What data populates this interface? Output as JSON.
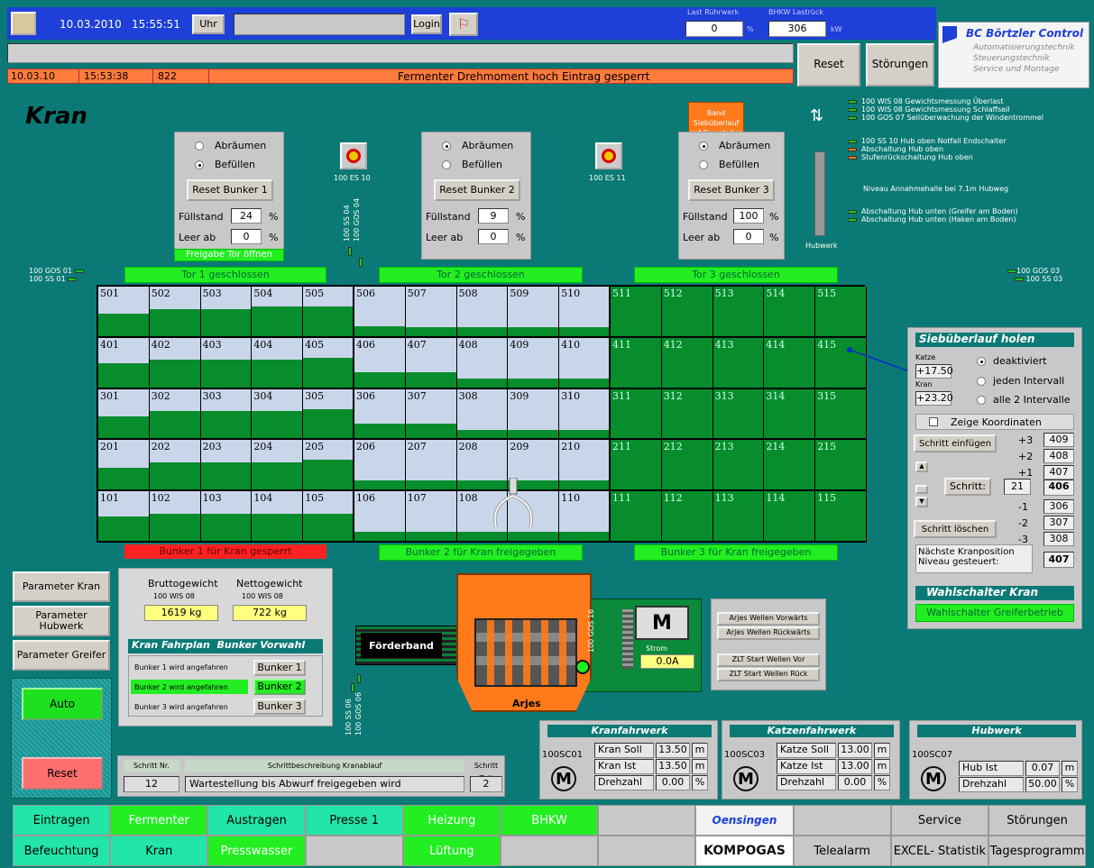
{
  "top": {
    "date": "10.03.2010",
    "time": "15:55:51",
    "uhr": "Uhr",
    "login": "Login",
    "last_ruehrwerk_label": "Last Rührwerk",
    "last_ruehrwerk": "0",
    "percent": "%",
    "bhkw_label": "BHKW Lastrück",
    "bhkw": "306",
    "kw": "kW",
    "reset": "Reset",
    "stoerungen": "Störungen"
  },
  "company": {
    "name": "BC Börtzler Control",
    "lines": [
      "Automatisierungstechnik",
      "Steuerungstechnik",
      "Service und Montage"
    ]
  },
  "alarm": {
    "date": "10.03.10",
    "time": "15:53:38",
    "code": "822",
    "message": "Fermenter Drehmoment hoch Eintrag gesperrt"
  },
  "title": "Kran",
  "bunkers": [
    {
      "opt1": "Abräumen",
      "opt2": "Befüllen",
      "reset": "Reset Bunker 1",
      "fill_label": "Füllstand",
      "fill": "24",
      "empty_label": "Leer ab",
      "empty": "0",
      "pct": "%",
      "extra": "Freigabe Tor öffnen",
      "gate": "Tor 1 geschlossen",
      "status": "Bunker 1 für Kran gesperrt"
    },
    {
      "opt1": "Abräumen",
      "opt2": "Befüllen",
      "reset": "Reset Bunker 2",
      "fill_label": "Füllstand",
      "fill": "9",
      "empty_label": "Leer ab",
      "empty": "0",
      "pct": "%",
      "gate": "Tor 2 geschlossen",
      "status": "Bunker 2 für Kran freigegeben"
    },
    {
      "opt1": "Abräumen",
      "opt2": "Befüllen",
      "reset": "Reset Bunker 3",
      "fill_label": "Füllstand",
      "fill": "100",
      "empty_label": "Leer ab",
      "empty": "0",
      "pct": "%",
      "band": "Band Siebüberlauf auf Box stellen",
      "gate": "Tor 3 geschlossen",
      "status": "Bunker 3 für Kran freigegeben"
    }
  ],
  "es": [
    "100 ES 10",
    "100 ES 11"
  ],
  "ss_small": [
    "100 SS 04",
    "100 GOS 04"
  ],
  "left_sensors": [
    "100 GOS 01",
    "100 SS 01"
  ],
  "right_sensors": [
    "100 GOS 03",
    "100 SS 03"
  ],
  "legend": [
    "100 WIS 08 Gewichtsmessung Überlast",
    "100 WIS 08 Gewichtsmessung Schlaffseil",
    "100 GOS 07 Seilüberwachung der Windentrommel",
    "100 SS 10 Hub oben Notfall Endschalter",
    "Abschaltung Hub oben",
    "Stufenrückschaltung Hub oben",
    "Niveau Annahmehalle bei 7.1m Hubweg",
    "Abschaltung Hub unten (Greifer am Boden)",
    "Abschaltung Hub unten (Haken am Boden)"
  ],
  "hubwerk_label": "Hubwerk",
  "grid": {
    "rows": [
      [
        "501",
        "502",
        "503",
        "504",
        "505",
        "506",
        "507",
        "508",
        "509",
        "510",
        "511",
        "512",
        "513",
        "514",
        "515"
      ],
      [
        "401",
        "402",
        "403",
        "404",
        "405",
        "406",
        "407",
        "408",
        "409",
        "410",
        "411",
        "412",
        "413",
        "414",
        "415"
      ],
      [
        "301",
        "302",
        "303",
        "304",
        "305",
        "306",
        "307",
        "308",
        "309",
        "310",
        "311",
        "312",
        "313",
        "314",
        "315"
      ],
      [
        "201",
        "202",
        "203",
        "204",
        "205",
        "206",
        "207",
        "208",
        "209",
        "210",
        "211",
        "212",
        "213",
        "214",
        "215"
      ],
      [
        "101",
        "102",
        "103",
        "104",
        "105",
        "106",
        "107",
        "108",
        "",
        "110",
        "111",
        "112",
        "113",
        "114",
        "115"
      ]
    ]
  },
  "right_panel": {
    "title": "Siebüberlauf holen",
    "katze_label": "Katze",
    "katze": "+17.50",
    "kran_label": "Kran",
    "kran": "+23.20",
    "opts": [
      "deaktiviert",
      "jeden Intervall",
      "alle 2 Intervalle"
    ],
    "coords": "Zeige Koordinaten",
    "insert": "Schritt einfügen",
    "delete": "Schritt löschen",
    "schritt_label": "Schritt:",
    "schritt": "21",
    "offsets": [
      "+3",
      "+2",
      "+1",
      "-1",
      "-2",
      "-3"
    ],
    "values": [
      "409",
      "408",
      "407",
      "406",
      "306",
      "307",
      "308"
    ],
    "next_label": "Nächste Kranposition Niveau gesteuert:",
    "next": "407",
    "wahl_title": "Wahlschalter Kran",
    "wahl": "Wahlschalter Greiferbetrieb"
  },
  "param_buttons": [
    "Parameter Kran",
    "Parameter Hubwerk",
    "Parameter Greifer"
  ],
  "auto": "Auto",
  "reset_btn": "Reset",
  "weights": {
    "brutto_label": "Bruttogewicht",
    "brutto_tag": "100 WIS 08",
    "brutto": "1619 kg",
    "netto_label": "Nettogewicht",
    "netto_tag": "100 WIS 08",
    "netto": "722 kg",
    "plan_title": "Kran Fahrplan  Bunker Vorwahl",
    "plan": [
      {
        "t": "Bunker 1 wird angefahren",
        "b": "Bunker 1"
      },
      {
        "t": "Bunker 2 wird angefahren",
        "b": "Bunker 2"
      },
      {
        "t": "Bunker 3 wird angefahren",
        "b": "Bunker 3"
      }
    ]
  },
  "arjes": {
    "band": "Förderband",
    "name": "Arjes",
    "gos": "100 GOS 16",
    "strom_label": "Strom",
    "strom": "0.0A",
    "ss06": [
      "100 SS 06",
      "100 GOS 06"
    ],
    "buttons": [
      "Arjes Wellen Vorwärts",
      "Arjes Wellen Rückwärts",
      "ZLT Start Wellen Vor",
      "ZLT Start Wellen Rück"
    ]
  },
  "schritt_bar": {
    "nr_label": "Schritt Nr.",
    "nr": "12",
    "desc_label": "Schrittbeschreibung Kranablauf",
    "desc": "Wartestellung bis Abwurf freigegeben wird",
    "zeit_label": "Schritt Zeit",
    "zeit": "2"
  },
  "drives": [
    {
      "title": "Kranfahrwerk",
      "id": "100SC01",
      "rows": [
        [
          "Kran Soll",
          "13.50",
          "m"
        ],
        [
          "Kran Ist",
          "13.50",
          "m"
        ],
        [
          "Drehzahl",
          "0.00",
          "%"
        ]
      ]
    },
    {
      "title": "Katzenfahrwerk",
      "id": "100SC03",
      "rows": [
        [
          "Katze Soll",
          "13.00",
          "m"
        ],
        [
          "Katze Ist",
          "13.00",
          "m"
        ],
        [
          "Drehzahl",
          "0.00",
          "%"
        ]
      ]
    },
    {
      "title": "Hubwerk",
      "id": "100SC07",
      "rows": [
        [
          "Hub Ist",
          "0.07",
          "m"
        ],
        [
          "Drehzahl",
          "50.00",
          "%"
        ]
      ]
    }
  ],
  "nav": {
    "row1": [
      "Eintragen",
      "Fermenter",
      "Austragen",
      "Presse 1",
      "Heizung",
      "BHKW",
      "",
      "Oensingen",
      "",
      "Service",
      "Störungen"
    ],
    "row2": [
      "Befeuchtung",
      "Kran",
      "Presswasser",
      "",
      "Lüftung",
      "",
      "",
      "KOMPOGAS",
      "Telealarm",
      "EXCEL- Statistik",
      "Tagesprogramm"
    ]
  },
  "colors": {
    "green_fill": "#078d2c",
    "empty_cell": "#c9d6ea",
    "bg": "#0b7a76"
  }
}
